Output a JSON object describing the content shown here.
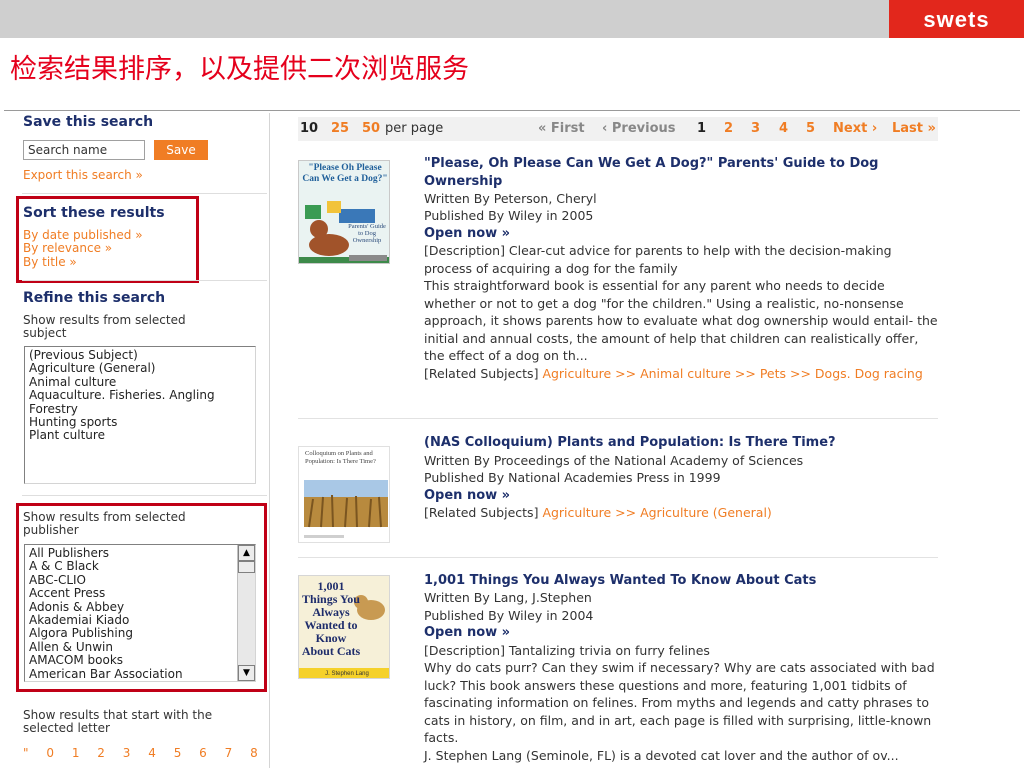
{
  "slide": {
    "title": "检索结果排序，以及提供二次浏览服务",
    "logo": "swets",
    "accent_color": "#e5001c",
    "link_color": "#f07d24",
    "heading_color": "#1d2f6b"
  },
  "sidebar": {
    "save": {
      "heading": "Save this search",
      "input_placeholder": "Search name",
      "button_label": "Save",
      "export_link": "Export this search »"
    },
    "sort": {
      "heading": "Sort these results",
      "options": [
        "By date published »",
        "By relevance »",
        "By title »"
      ]
    },
    "refine": {
      "heading": "Refine this search",
      "subject_label": "Show results from selected subject",
      "subjects": [
        "(Previous Subject)",
        "Agriculture (General)",
        "Animal culture",
        "Aquaculture. Fisheries. Angling",
        "Forestry",
        "Hunting sports",
        "Plant culture"
      ],
      "publisher_label": "Show results from selected publisher",
      "publishers": [
        "All Publishers",
        "A & C Black",
        "ABC-CLIO",
        "Accent Press",
        "Adonis & Abbey",
        "Akademiai Kiado",
        "Algora Publishing",
        "Allen & Unwin",
        "AMACOM books",
        "American Bar Association"
      ],
      "letter_label": "Show results that start with the selected letter",
      "letters": [
        "\"",
        "0",
        "1",
        "2",
        "3",
        "4",
        "5",
        "6",
        "7",
        "8"
      ]
    }
  },
  "pager": {
    "per_page_options": [
      "10",
      "25",
      "50"
    ],
    "per_page_label": "per page",
    "first": "« First",
    "previous": "‹ Previous",
    "pages": [
      "1",
      "2",
      "3",
      "4",
      "5"
    ],
    "current_page": "1",
    "next": "Next ›",
    "last": "Last »"
  },
  "results": [
    {
      "cover_text": "\"Please Oh Please Can We Get a Dog?\"",
      "cover_subtitle": "Parents' Guide to Dog Ownership",
      "title": "\"Please, Oh Please Can We Get A Dog?\" Parents' Guide to Dog Ownership",
      "author": "Written By Peterson, Cheryl",
      "publisher": "Published By Wiley in 2005",
      "open_now": "Open now »",
      "description": "[Description] Clear-cut advice for parents to help with the decision-making process of acquiring a dog for the family",
      "summary": "This straightforward book is essential for any parent who needs to decide whether or not to get a dog \"for the children.\" Using a realistic, no-nonsense approach, it shows parents how to evaluate what dog ownership would entail- the initial and annual costs, the amount of help that children can realistically offer, the effect of a dog on th...",
      "subjects_label": "[Related Subjects]",
      "subjects_path": "Agriculture >> Animal culture >> Pets >> Dogs. Dog racing"
    },
    {
      "cover_text": "Colloquium on Plants and Population: Is There Time?",
      "title": "(NAS Colloquium) Plants and Population: Is There Time?",
      "author": "Written By Proceedings of the National Academy of Sciences",
      "publisher": "Published By National Academies Press in 1999",
      "open_now": "Open now »",
      "subjects_label": "[Related Subjects]",
      "subjects_path": "Agriculture >> Agriculture (General)"
    },
    {
      "cover_text": "1,001 Things You Always Wanted to Know About Cats",
      "cover_author": "J. Stephen Lang",
      "title": "1,001 Things You Always Wanted To Know About Cats",
      "author": "Written By Lang, J.Stephen",
      "publisher": "Published By Wiley in 2004",
      "open_now": "Open now »",
      "description": "[Description] Tantalizing trivia on furry felines",
      "summary": "Why do cats purr? Can they swim if necessary? Why are cats associated with bad luck? This book answers these questions and more, featuring 1,001 tidbits of fascinating information on felines. From myths and legends and catty phrases to cats in history, on film, and in art, each page is filled with surprising, little-known facts.",
      "author_note": "J. Stephen Lang (Seminole, FL) is a devoted cat lover and the author of ov..."
    }
  ]
}
